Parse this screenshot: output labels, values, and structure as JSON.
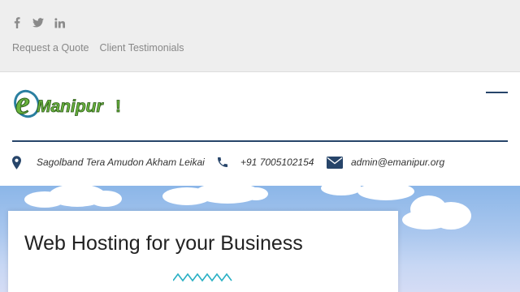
{
  "social": [
    {
      "icon": "facebook-icon"
    },
    {
      "icon": "twitter-icon"
    },
    {
      "icon": "linkedin-icon"
    }
  ],
  "top_links": {
    "quote": "Request a Quote",
    "testimonials": "Client Testimonials"
  },
  "logo": {
    "e_letter": "e",
    "text": "Manipur",
    "mark": "!"
  },
  "contact": {
    "address": "Sagolband Tera Amudon Akham Leikai",
    "phone": "+91 7005102154",
    "email": "admin@emanipur.org"
  },
  "hero": {
    "title": "Web Hosting for your Business"
  },
  "colors": {
    "accent": "#27456a",
    "zigzag": "#2ab0c4",
    "logo_green": "#6ab33e",
    "topbar_bg": "#eeeeee"
  }
}
